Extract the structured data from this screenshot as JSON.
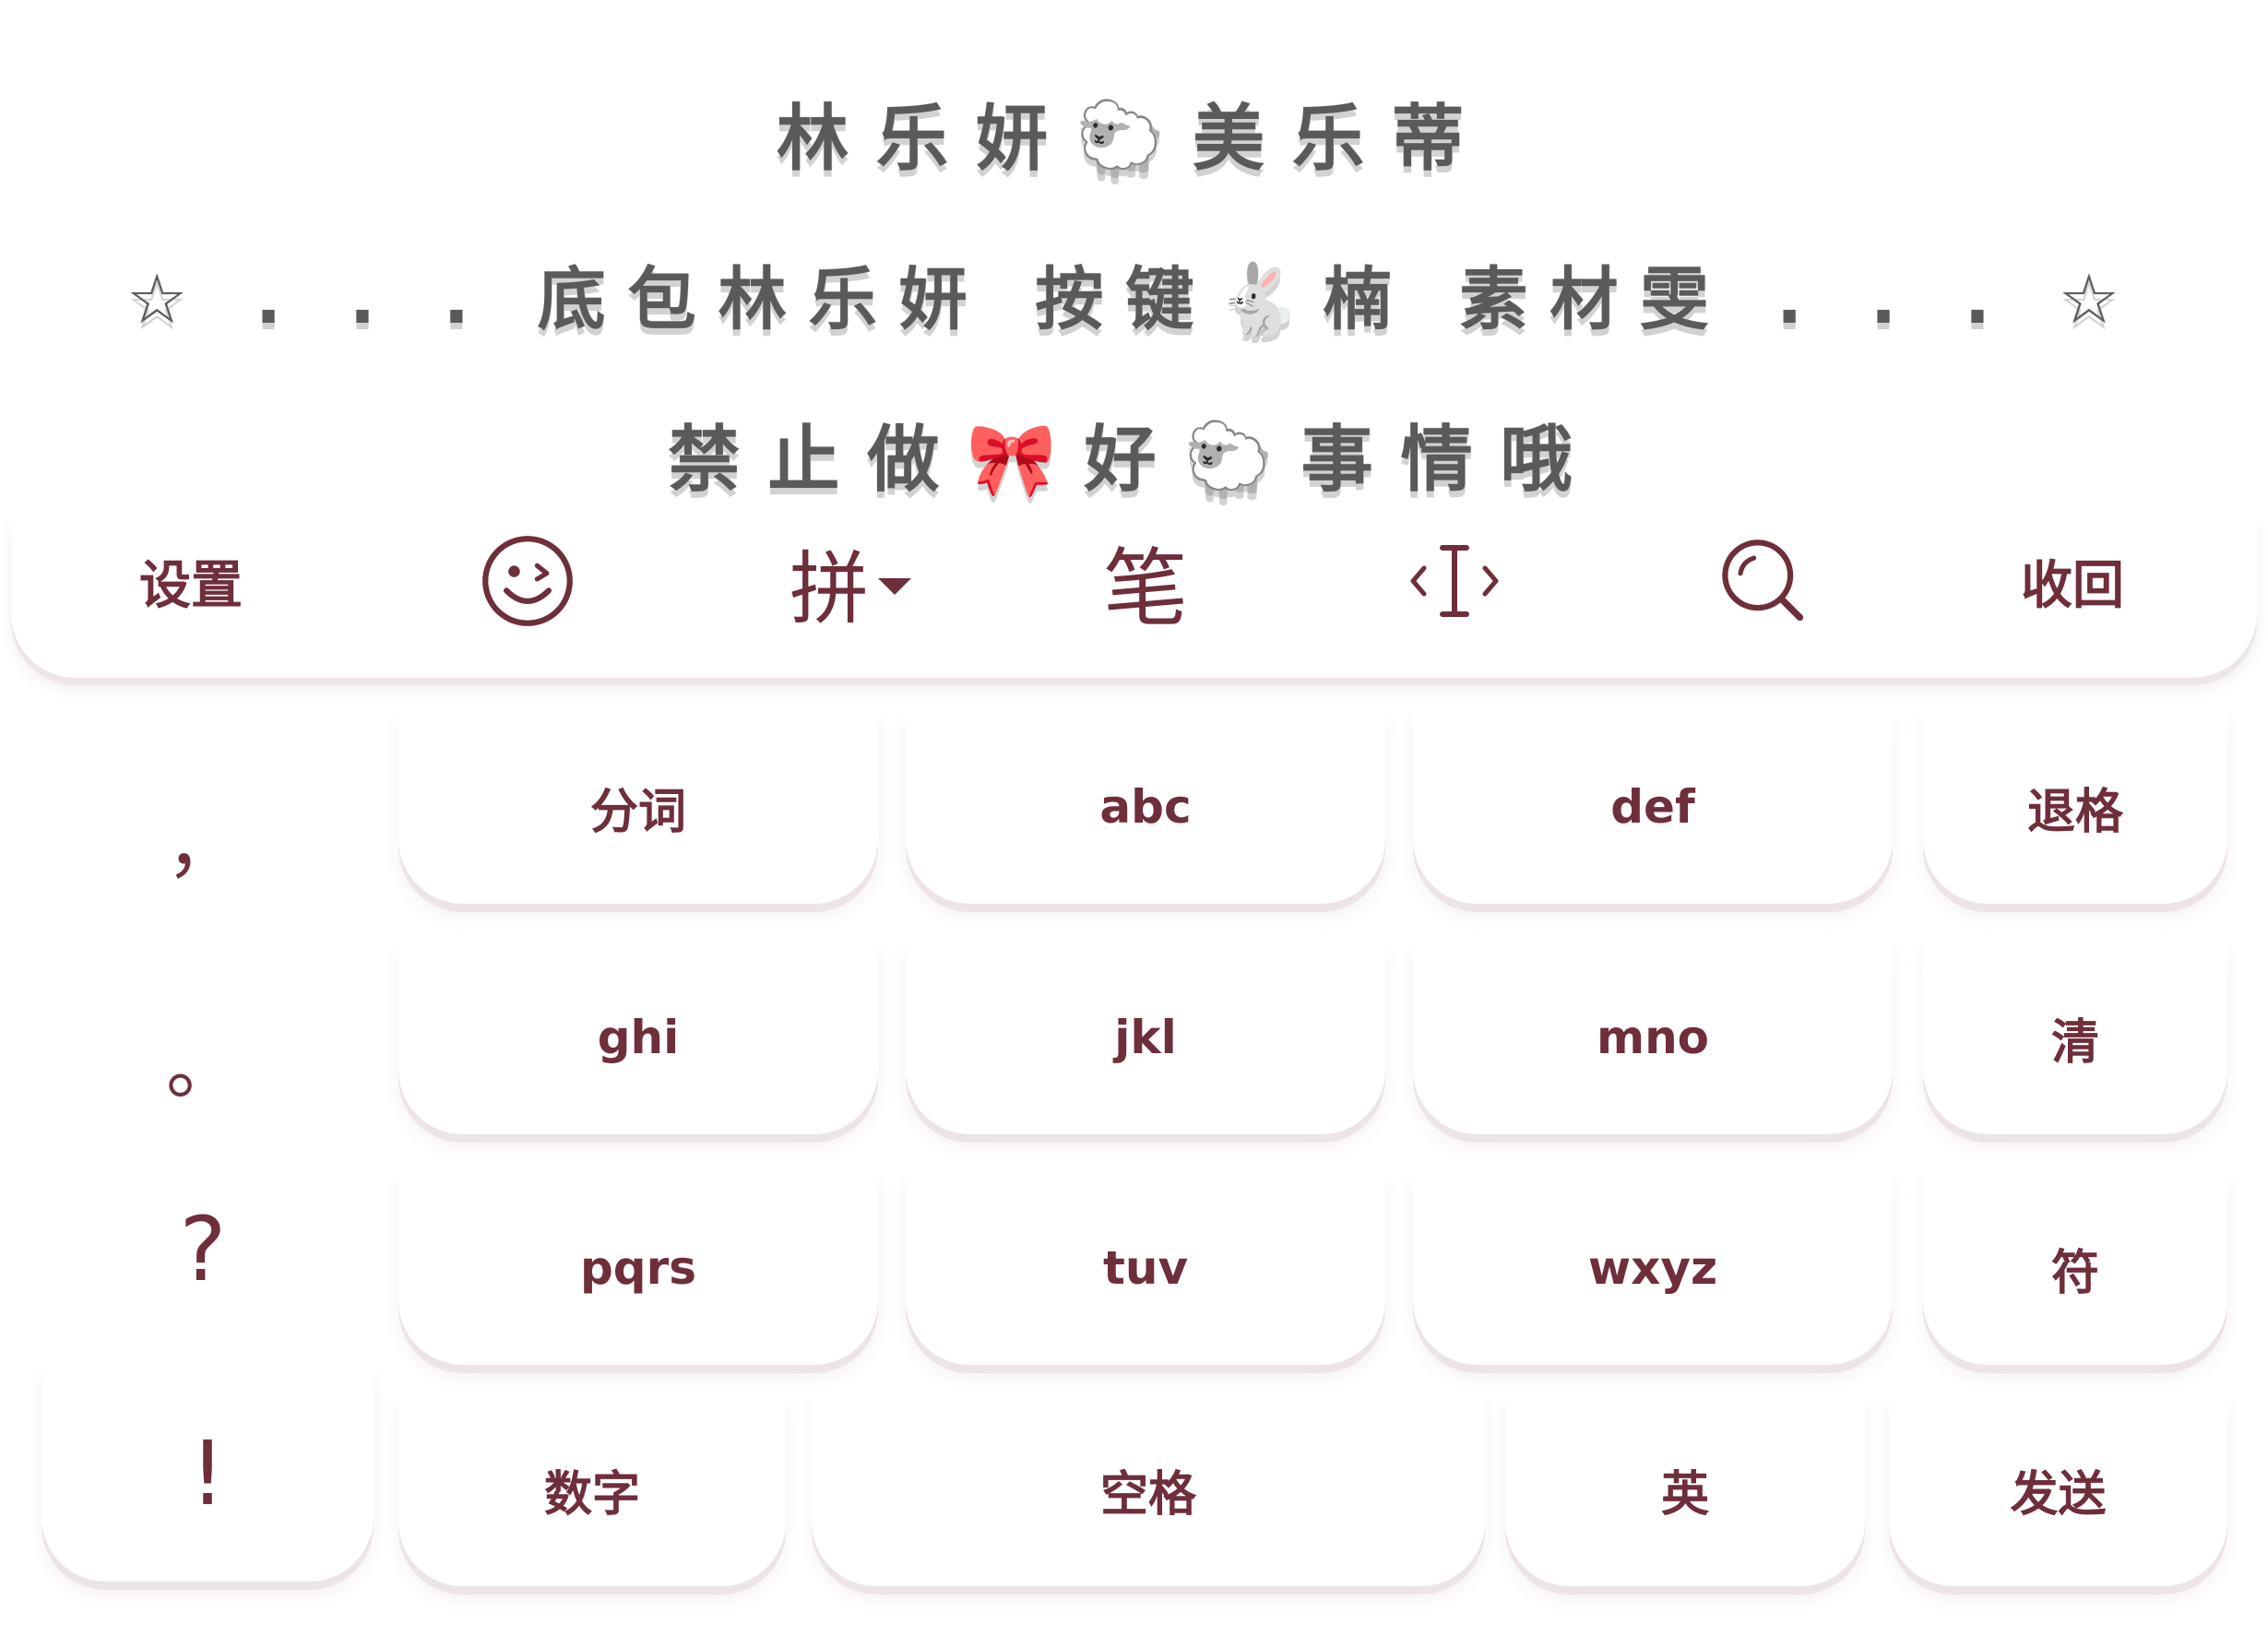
{
  "banner": {
    "line1": "林乐妍🐑美乐蒂",
    "line2": "☆ . . . 底包林乐妍 按键🐇楠 素材雯 . . . ☆",
    "line3": "禁止做🎀好🐑事情哦"
  },
  "toolbar": {
    "settings_label": "设置",
    "emoji_icon": "smiley-wink-icon",
    "pinyin_label": "拼",
    "stroke_label": "笔",
    "cursor_icon": "text-cursor-icon",
    "search_icon": "search-icon",
    "collapse_label": "收回"
  },
  "punctuation": {
    "comma": "，",
    "period": "。",
    "question": "?",
    "exclaim": "!"
  },
  "keys": {
    "fenci": "分词",
    "abc": "abc",
    "def": "def",
    "backspace": "退格",
    "ghi": "ghi",
    "jkl": "jkl",
    "mno": "mno",
    "clear": "清",
    "pqrs": "pqrs",
    "tuv": "tuv",
    "wxyz": "wxyz",
    "symbol": "符",
    "number": "数字",
    "space": "空格",
    "english": "英",
    "send": "发送"
  },
  "colors": {
    "key_text": "#6e2e3a",
    "banner_text": "#5a5a5a",
    "key_shadow": "#ece4e7"
  }
}
